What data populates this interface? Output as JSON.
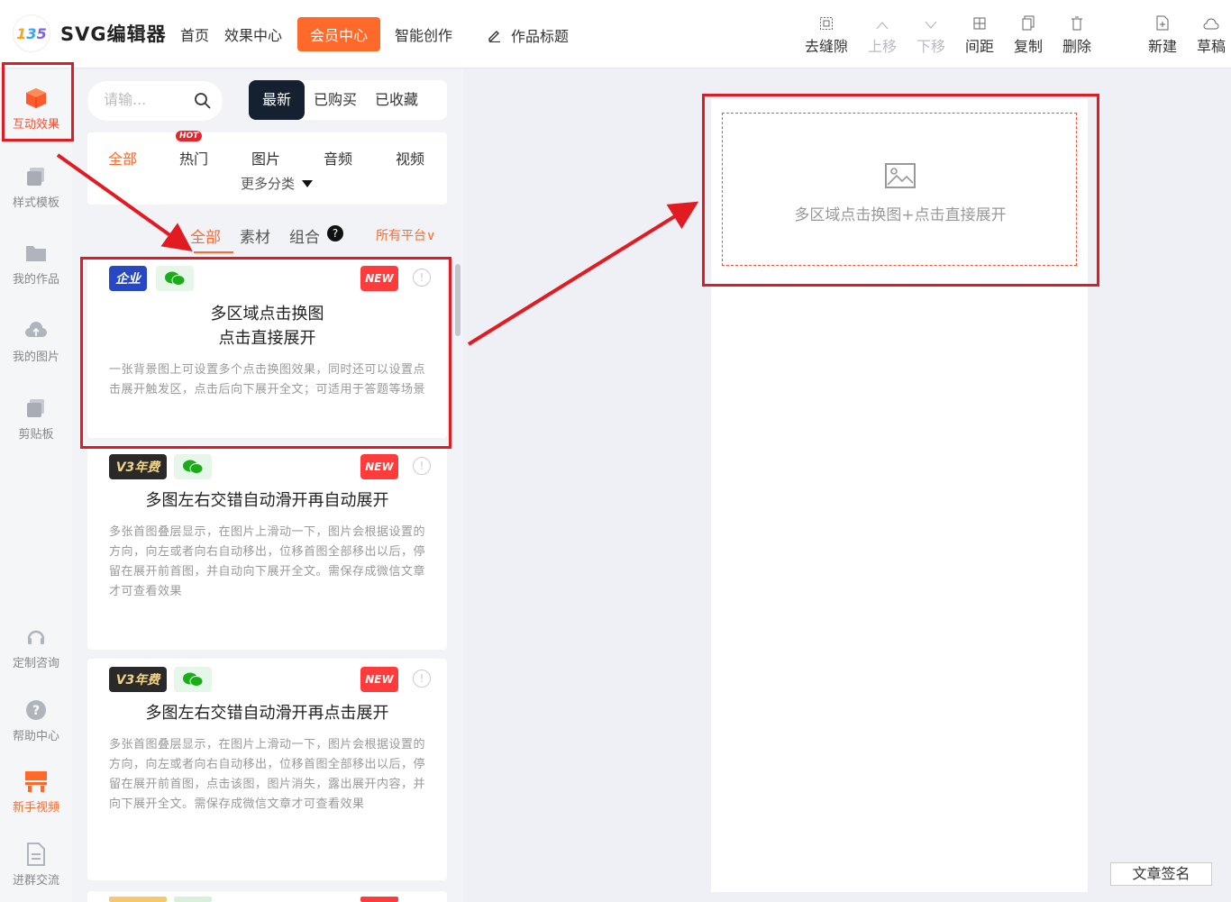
{
  "header": {
    "logo_text": [
      "1",
      "3",
      "5"
    ],
    "brand": "SVG编辑器",
    "nav": [
      "首页",
      "效果中心",
      "会员中心",
      "智能创作"
    ],
    "active_nav": "会员中心",
    "title_placeholder": "作品标题"
  },
  "toolbar": {
    "remove_gap": "去缝隙",
    "move_up": "上移",
    "move_down": "下移",
    "spacing": "间距",
    "copy": "复制",
    "delete": "删除",
    "new": "新建",
    "draft": "草稿"
  },
  "rail": {
    "interactive": "互动效果",
    "templates": "样式模板",
    "works": "我的作品",
    "images": "我的图片",
    "clipboard": "剪贴板",
    "consult": "定制咨询",
    "help": "帮助中心",
    "tutorial": "新手视频",
    "group": "进群交流"
  },
  "panel": {
    "search_placeholder": "请输...",
    "sort_tabs": [
      "最新",
      "已购买",
      "已收藏"
    ],
    "categories": [
      "全部",
      "热门",
      "图片",
      "音频",
      "视频"
    ],
    "hot_badge": "HOT",
    "more_categories": "更多分类",
    "sub_tabs": [
      "全部",
      "素材",
      "组合"
    ],
    "help_mark": "?",
    "platform_filter": "所有平台∨",
    "cards": [
      {
        "badge": "企业",
        "new": "NEW",
        "title_line1": "多区域点击换图",
        "title_line2": "点击直接展开",
        "desc": "一张背景图上可设置多个点击换图效果，同时还可以设置点击展开触发区，点击后向下展开全文；可适用于答题等场景"
      },
      {
        "badge": "V3年费",
        "new": "NEW",
        "title_line1": "多图左右交错自动滑开再自动展开",
        "desc": "多张首图叠层显示，在图片上滑动一下，图片会根据设置的方向，向左或者向右自动移出，位移首图全部移出以后，停留在展开前首图，并自动向下展开全文。需保存成微信文章才可查看效果"
      },
      {
        "badge": "V3年费",
        "new": "NEW",
        "title_line1": "多图左右交错自动滑开再点击展开",
        "desc": "多张首图叠层显示，在图片上滑动一下，图片会根据设置的方向，向左或者向右自动移出，位移首图全部移出以后，停留在展开前首图，点击该图，图片消失，露出展开内容，并向下展开全文。需保存成微信文章才可查看效果"
      }
    ]
  },
  "canvas": {
    "placeholder_text": "多区域点击换图+点击直接展开",
    "signature_button": "文章签名"
  },
  "colors": {
    "accent": "#ff6a2b",
    "annotation": "#e21b22",
    "dark_tab": "#152030"
  }
}
